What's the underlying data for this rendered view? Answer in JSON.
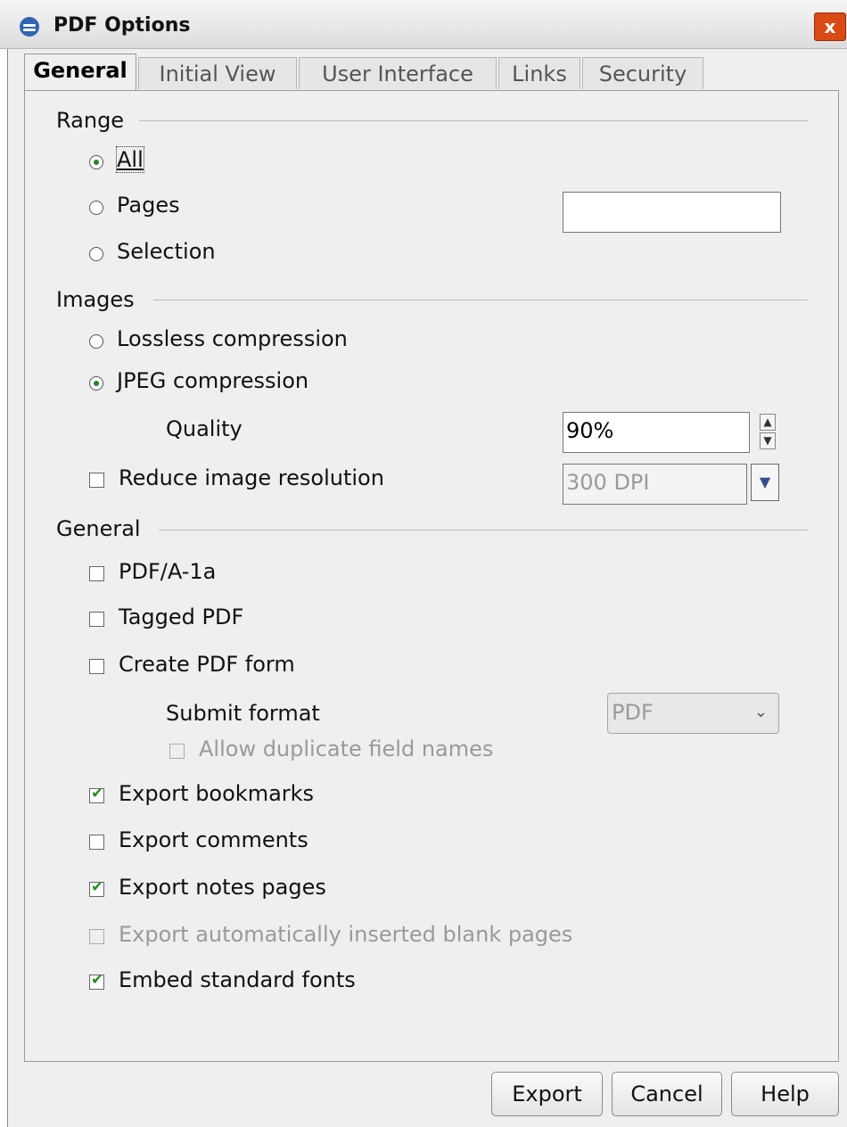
{
  "window": {
    "title": "PDF Options",
    "close_symbol": "x"
  },
  "tabs": [
    {
      "label": "General",
      "active": true
    },
    {
      "label": "Initial View"
    },
    {
      "label": "User Interface"
    },
    {
      "label": "Links"
    },
    {
      "label": "Security"
    }
  ],
  "range": {
    "title": "Range",
    "all": "All",
    "pages": "Pages",
    "selection": "Selection",
    "pages_value": "",
    "selected": "all"
  },
  "images": {
    "title": "Images",
    "lossless": "Lossless compression",
    "jpeg": "JPEG compression",
    "quality_label": "Quality",
    "quality_value": "90%",
    "reduce_label": "Reduce image resolution",
    "resolution_value": "300 DPI",
    "selected": "jpeg"
  },
  "general": {
    "title": "General",
    "pdfa": "PDF/A-1a",
    "tagged": "Tagged PDF",
    "create_form": "Create PDF form",
    "submit_format_label": "Submit format",
    "submit_format_value": "PDF",
    "allow_dup": "Allow duplicate field names",
    "export_bookmarks": "Export bookmarks",
    "export_comments": "Export comments",
    "export_notes": "Export notes pages",
    "export_blank": "Export automatically inserted blank pages",
    "embed_fonts": "Embed standard fonts"
  },
  "buttons": {
    "export": "Export",
    "cancel": "Cancel",
    "help": "Help"
  }
}
